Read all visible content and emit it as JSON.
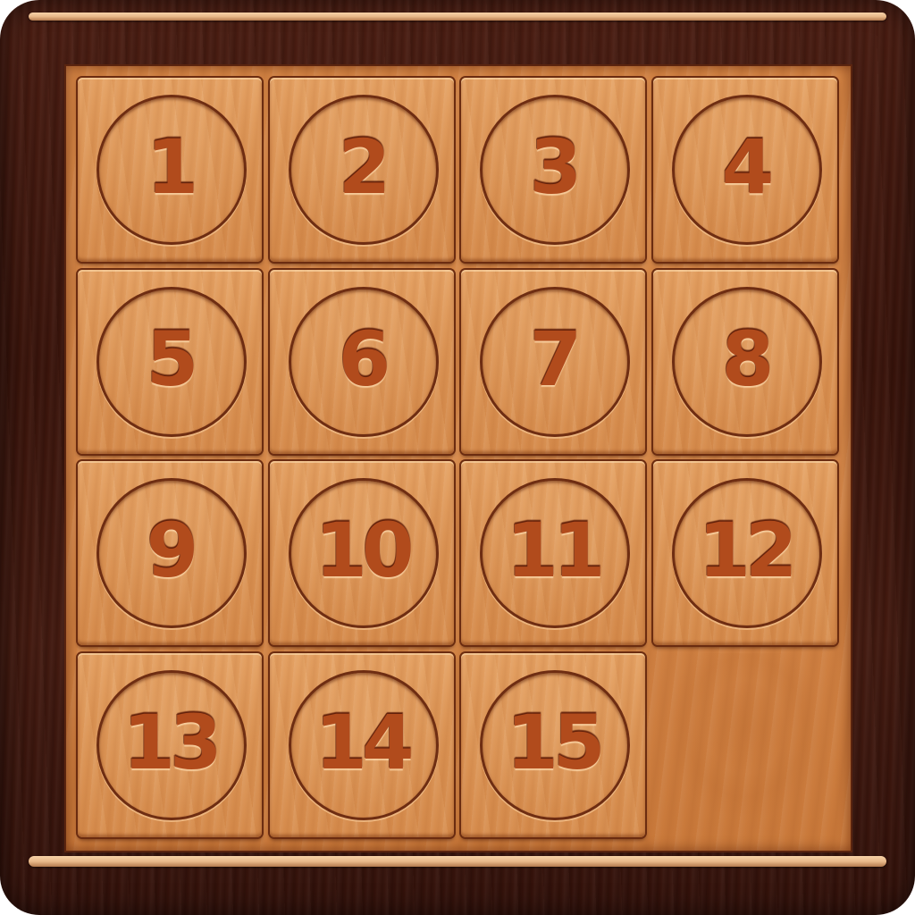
{
  "game": {
    "type": "15-puzzle",
    "grid_size": 4,
    "tiles": [
      {
        "label": "1"
      },
      {
        "label": "2"
      },
      {
        "label": "3"
      },
      {
        "label": "4"
      },
      {
        "label": "5"
      },
      {
        "label": "6"
      },
      {
        "label": "7"
      },
      {
        "label": "8"
      },
      {
        "label": "9"
      },
      {
        "label": "10"
      },
      {
        "label": "11"
      },
      {
        "label": "12"
      },
      {
        "label": "13"
      },
      {
        "label": "14"
      },
      {
        "label": "15"
      }
    ],
    "empty_cell": {
      "row": 4,
      "col": 4
    }
  },
  "colors": {
    "frame": "#3f170d",
    "board": "#d38444",
    "tile": "#dc9556",
    "numeral": "#b14b1c"
  }
}
